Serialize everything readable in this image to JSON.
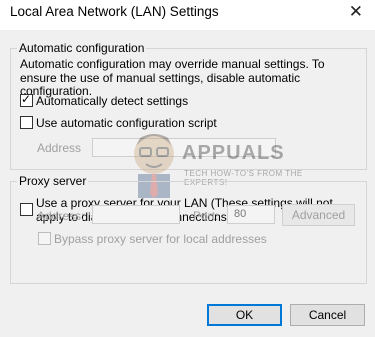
{
  "window": {
    "title": "Local Area Network (LAN) Settings",
    "close_glyph": "✕"
  },
  "auto_config": {
    "legend": "Automatic configuration",
    "description": "Automatic configuration may override manual settings.  To ensure the use of manual settings, disable automatic configuration.",
    "detect": {
      "label": "Automatically detect settings",
      "checked": true
    },
    "script": {
      "label": "Use automatic configuration script",
      "checked": false
    },
    "address_label": "Address",
    "address_value": ""
  },
  "proxy": {
    "legend": "Proxy server",
    "use_proxy": {
      "label": "Use a proxy server for your LAN (These settings will not apply to dial-up or VPN connections).",
      "checked": false
    },
    "address_label": "Address:",
    "address_value": "",
    "port_label": "Port:",
    "port_value": "80",
    "advanced_label": "Advanced",
    "bypass": {
      "label": "Bypass proxy server for local addresses",
      "checked": false
    }
  },
  "buttons": {
    "ok": "OK",
    "cancel": "Cancel"
  },
  "watermark": {
    "brand": "APPUALS",
    "tagline": "TECH HOW-TO'S FROM THE EXPERTS!"
  },
  "colors": {
    "dialog_bg": "#f0f0f0",
    "ok_border": "#0078d7",
    "disabled_text": "#a0a0a0"
  }
}
